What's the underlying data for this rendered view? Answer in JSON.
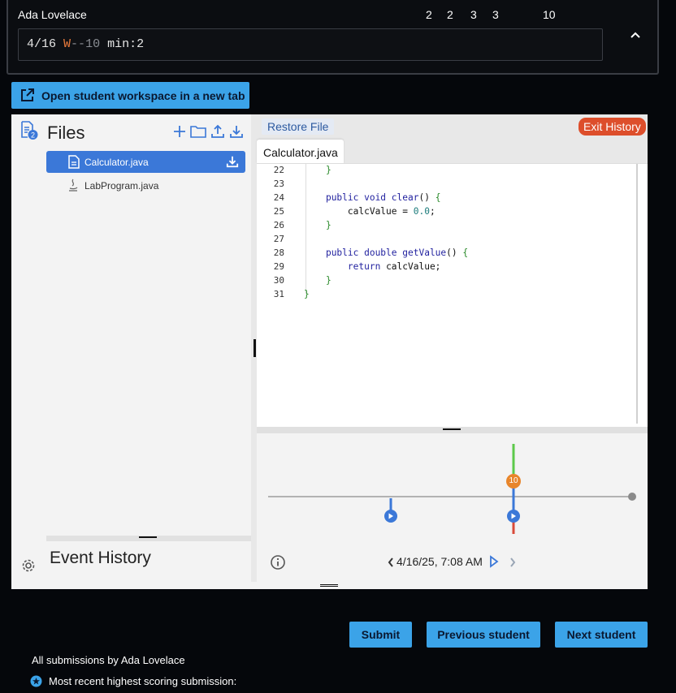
{
  "student": {
    "name": "Ada Lovelace",
    "scores": [
      "2",
      "2",
      "3",
      "3",
      "10"
    ],
    "summary_date": "4/16",
    "summary_flag": "W",
    "summary_dashes": "--",
    "summary_count": "10",
    "summary_min": "min:2"
  },
  "open_workspace_label": "Open student workspace in a new tab",
  "files_panel": {
    "title": "Files",
    "badge": "2",
    "files": [
      {
        "name": "Calculator.java",
        "selected": true
      },
      {
        "name": "LabProgram.java",
        "selected": false
      }
    ]
  },
  "event_history_title": "Event History",
  "editor": {
    "restore_label": "Restore File",
    "exit_label": "Exit History",
    "tab_label": "Calculator.java",
    "line_numbers": [
      "22",
      "23",
      "24",
      "25",
      "26",
      "27",
      "28",
      "29",
      "30",
      "31"
    ]
  },
  "timeline": {
    "timestamp": "4/16/25, 7:08 AM",
    "score_badge": "10"
  },
  "actions": {
    "submit": "Submit",
    "previous": "Previous student",
    "next": "Next student"
  },
  "footer": {
    "all_submissions": "All submissions by Ada Lovelace",
    "recent_highest": "Most recent highest scoring submission:"
  },
  "colors": {
    "accent_blue": "#3ba3e8",
    "selected_file": "#3b78d8",
    "exit_red": "#dd4e2b",
    "marker_orange": "#e8852a",
    "marker_green": "#5cc94a",
    "marker_blue": "#3b78d8"
  }
}
